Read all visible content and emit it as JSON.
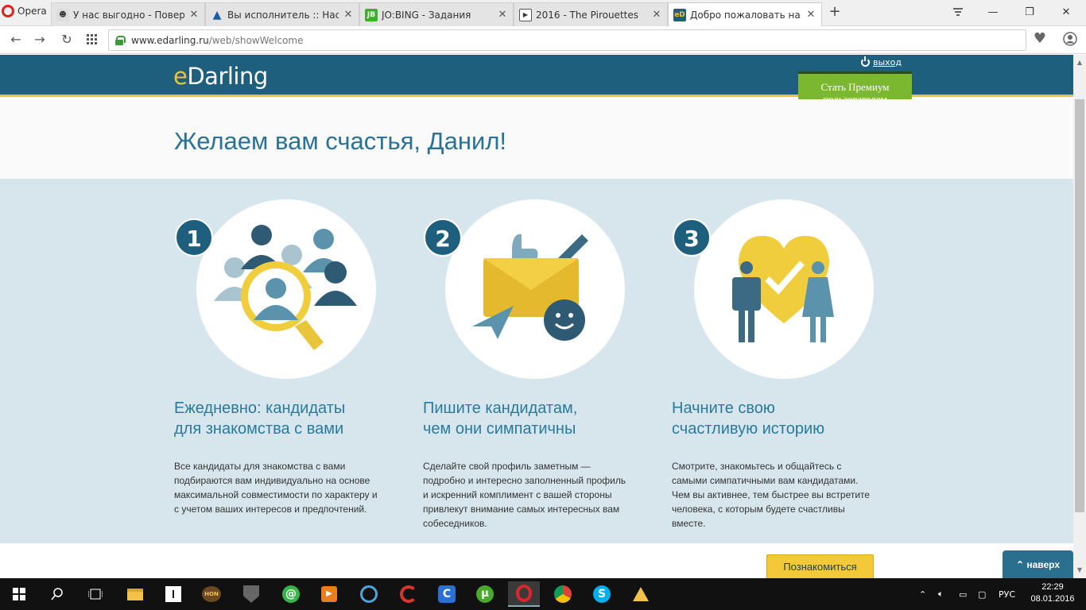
{
  "browser": {
    "menu_label": "Opera",
    "tabs": [
      {
        "title": "У нас выгодно - Поверь в",
        "favicon": "user-icon"
      },
      {
        "title": "Вы исполнитель :: Настро",
        "favicon": "triangle-icon"
      },
      {
        "title": "JO:BING - Задания",
        "favicon": "jobing-icon",
        "favicon_text": "JB"
      },
      {
        "title": "2016 - The Pirouettes",
        "favicon": "play-icon"
      },
      {
        "title": "Добро пожаловать на eD",
        "favicon": "edarling-icon",
        "favicon_text": "eD",
        "active": true
      }
    ],
    "url_host": "www.edarling.ru",
    "url_path": "/web/showWelcome"
  },
  "site": {
    "logo_e": "e",
    "logo_rest": "Darling",
    "logout_label": "выход",
    "premium_line1": "Стать Премиум",
    "premium_line2": "пользователем",
    "welcome_title": "Желаем вам счастья, Данил!",
    "steps": [
      {
        "number": "1",
        "title_line1": "Ежедневно: кандидаты",
        "title_line2": "для знакомства с вами",
        "text": "Все кандидаты для знакомства с вами подбираются вам индивидуально на основе максимальной совместимости по характеру и с учетом ваших интересов и предпочтений."
      },
      {
        "number": "2",
        "title_line1": "Пишите кандидатам,",
        "title_line2": "чем они симпатичны",
        "text": "Сделайте свой профиль заметным — подробно и интересно заполненный профиль и искренний комплимент с вашей стороны привлекут внимание самых интересных вам собеседников."
      },
      {
        "number": "3",
        "title_line1": "Начните свою",
        "title_line2": "счастливую историю",
        "text": "Смотрите, знакомьтесь и общайтесь с самыми симпатичными вам кандидатами. Чем вы активнее, тем быстрее вы встретите человека, с которым будете счастливы вместе."
      }
    ],
    "meet_button": "Познакомиться",
    "to_top_label": "наверх"
  },
  "taskbar": {
    "lang": "РУС",
    "time": "22:29",
    "date": "08.01.2016"
  },
  "colors": {
    "header": "#1f5f7e",
    "accent_yellow": "#f0c338",
    "premium_green": "#7cb82f",
    "steps_bg": "#d6e6ec",
    "title_blue": "#2a7196"
  }
}
